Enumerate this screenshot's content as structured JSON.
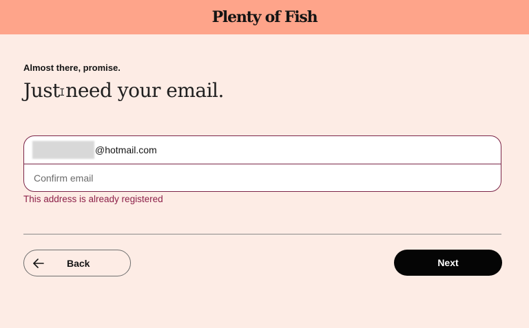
{
  "header": {
    "logo_text": "Plenty of Fish",
    "brand_color": "#fea48a"
  },
  "main": {
    "subtitle": "Almost there, promise.",
    "heading": "Just need your email.",
    "email": {
      "value_suffix": "@hotmail.com",
      "redacted": true
    },
    "confirm_email": {
      "value": "",
      "placeholder": "Confirm email"
    },
    "error_message": "This address is already registered",
    "error_color": "#8c1f48"
  },
  "actions": {
    "back_label": "Back",
    "next_label": "Next",
    "back_icon": "arrow-left-icon"
  }
}
